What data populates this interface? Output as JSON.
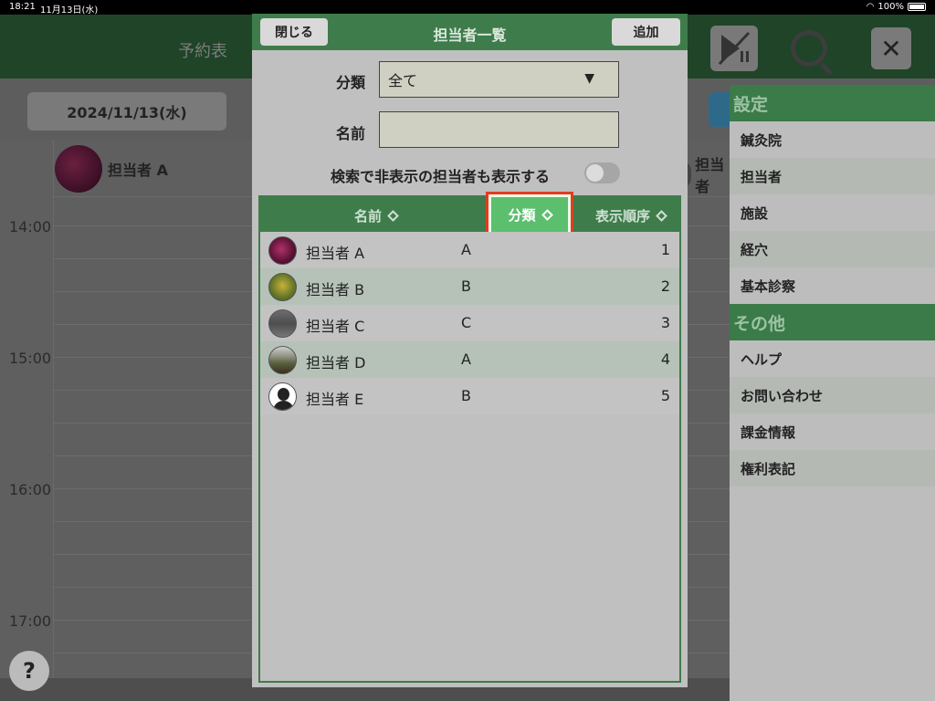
{
  "status_bar": {
    "time": "18:21",
    "date": "11月13日(水)",
    "battery": "100%"
  },
  "app": {
    "title": "予約表",
    "date_button": "2024/11/13(水)"
  },
  "schedule": {
    "staff": [
      "担当者 A",
      "担当者"
    ],
    "times": [
      "14:00",
      "15:00",
      "16:00",
      "17:00"
    ],
    "help_label": "?"
  },
  "side_menu": {
    "sections": [
      {
        "title": "設定",
        "items": [
          "鍼灸院",
          "担当者",
          "施設",
          "経穴",
          "基本診察"
        ]
      },
      {
        "title": "その他",
        "items": [
          "ヘルプ",
          "お問い合わせ",
          "課金情報",
          "権利表記"
        ]
      }
    ]
  },
  "modal": {
    "title": "担当者一覧",
    "close_label": "閉じる",
    "add_label": "追加",
    "category_label": "分類",
    "category_value": "全て",
    "name_label": "名前",
    "name_value": "",
    "show_hidden_label": "検索で非表示の担当者も表示する",
    "show_hidden_on": false,
    "columns": {
      "name": "名前",
      "category": "分類",
      "order": "表示順序"
    },
    "rows": [
      {
        "name": "担当者 A",
        "category": "A",
        "order": "1"
      },
      {
        "name": "担当者 B",
        "category": "B",
        "order": "2"
      },
      {
        "name": "担当者 C",
        "category": "C",
        "order": "3"
      },
      {
        "name": "担当者 D",
        "category": "A",
        "order": "4"
      },
      {
        "name": "担当者 E",
        "category": "B",
        "order": "5"
      }
    ]
  },
  "colors": {
    "primary_green": "#3f7c4b",
    "highlight_green": "#5cbf6e",
    "highlight_outline": "#e23b21"
  }
}
